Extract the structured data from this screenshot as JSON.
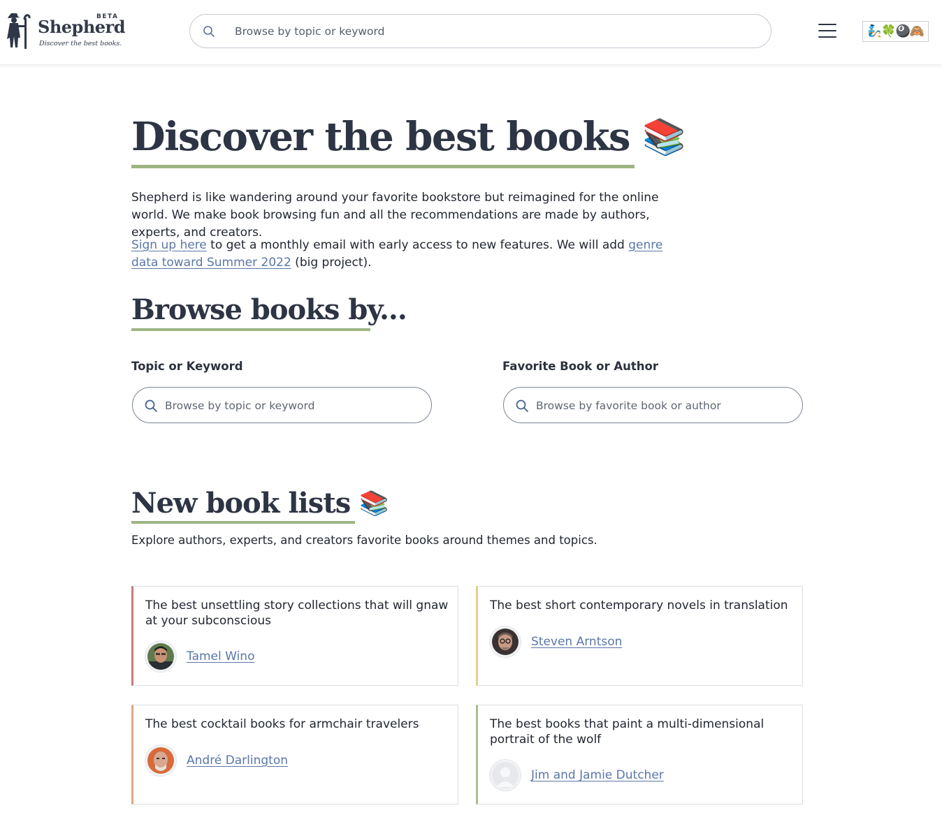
{
  "header": {
    "logo": {
      "badge": "BETA",
      "name": "Shepherd",
      "tagline": "Discover the best books."
    },
    "search": {
      "placeholder": "Browse by topic or keyword",
      "icon": "search-icon"
    },
    "menu_icon": "hamburger-menu-icon",
    "emoji_badge": "🧞🍀🎱🙈"
  },
  "hero": {
    "title": "Discover the best books",
    "title_emoji": "📚",
    "paragraph1": "Shepherd is like wandering around your favorite bookstore but reimagined for the online world. We make book browsing fun and all the recommendations are made by authors, experts, and creators.",
    "paragraph2": {
      "link1": "Sign up here",
      "text1": " to get a monthly email with early access to new features. We will add ",
      "link2": "genre data toward Summer 2022",
      "text2": " (big project)."
    }
  },
  "browse": {
    "title": "Browse books by...",
    "topic": {
      "label": "Topic or Keyword",
      "placeholder": "Browse by topic or keyword"
    },
    "favorite": {
      "label": "Favorite Book or Author",
      "placeholder": "Browse by favorite book or author"
    }
  },
  "lists": {
    "title": "New book lists",
    "title_emoji": "📚",
    "description": "Explore authors, experts, and creators favorite books around themes and topics.",
    "cards": [
      {
        "title": "The best unsettling story collections that will gnaw at your subconscious",
        "author": "Tamel Wino",
        "accent": "#c97a7e"
      },
      {
        "title": "The best short contemporary novels in translation",
        "author": "Steven Arntson",
        "accent": "#e6cf86"
      },
      {
        "title": "The best cocktail books for armchair travelers",
        "author": "André Darlington",
        "accent": "#e0a48a"
      },
      {
        "title": "The best books that paint a multi-dimensional portrait of the wolf",
        "author": "Jim and Jamie Dutcher",
        "accent": "#a9c08f"
      }
    ]
  },
  "colors": {
    "accent_rule": "#9eb483",
    "link": "#5a76a8",
    "heading": "#2d3444"
  }
}
